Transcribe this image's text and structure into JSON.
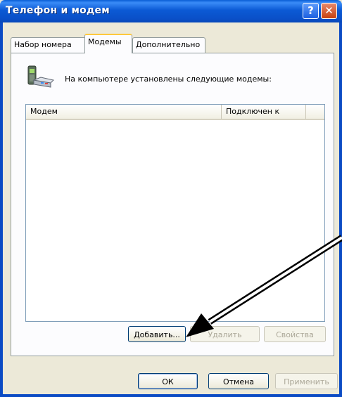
{
  "window": {
    "title": "Телефон и модем",
    "help_label": "?",
    "close_label": "✕"
  },
  "tabs": [
    {
      "label": "Набор номера",
      "active": false
    },
    {
      "label": "Модемы",
      "active": true
    },
    {
      "label": "Дополнительно",
      "active": false
    }
  ],
  "modems": {
    "header_text": "На компьютере установлены следующие модемы:",
    "columns": [
      "Модем",
      "Подключен к"
    ],
    "rows": [],
    "add_label": "Добавить...",
    "remove_label": "Удалить",
    "properties_label": "Свойства"
  },
  "footer": {
    "ok_label": "ОК",
    "cancel_label": "Отмена",
    "apply_label": "Применить"
  },
  "colors": {
    "titlebar": "#0a5fd6",
    "dialog_bg": "#ece9d8",
    "active_tab_accent": "#ffc83c"
  }
}
